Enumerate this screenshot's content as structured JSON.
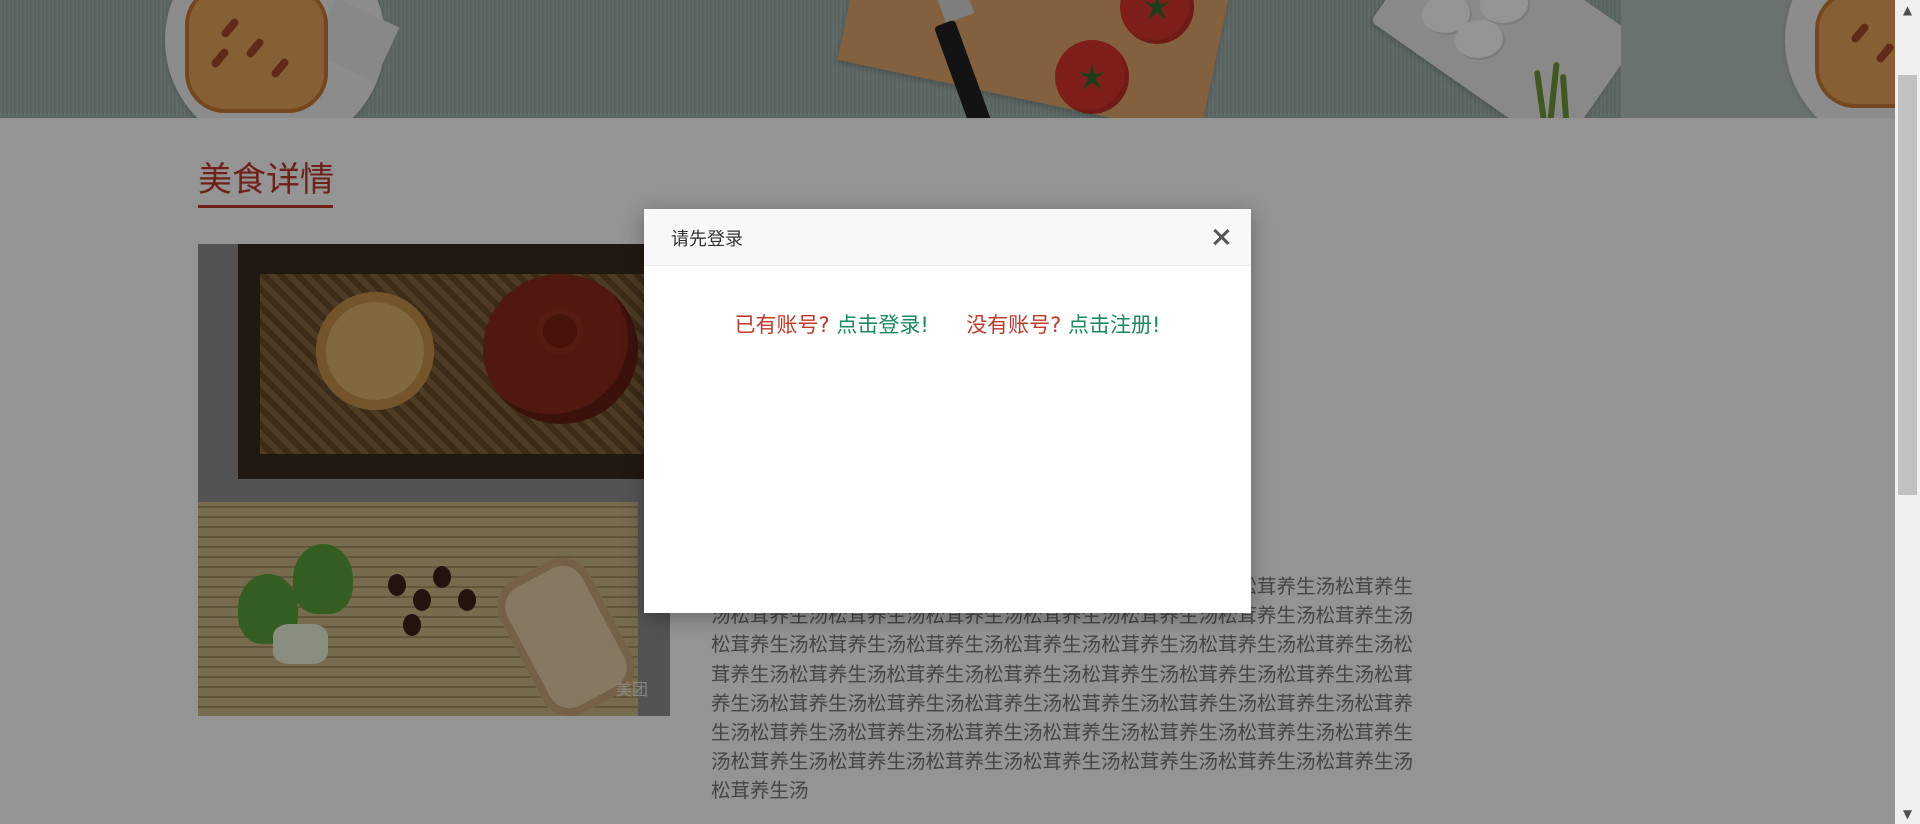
{
  "section": {
    "title": "美食详情"
  },
  "photo": {
    "watermark": "美团"
  },
  "description": {
    "text": "生汤松茸养生汤松茸养生汤松茸养生汤松茸养生汤松茸养生汤松茸养生汤松茸养生汤松茸养生汤松茸养生汤松茸养生汤松茸养生汤松茸养生汤松茸养生汤松茸养生汤松茸养生汤松茸养生汤松茸养生汤松茸养生汤松茸养生汤松茸养生汤松茸养生汤松茸养生汤松茸养生汤松茸养生汤松茸养生汤松茸养生汤松茸养生汤松茸养生汤松茸养生汤松茸养生汤松茸养生汤松茸养生汤松茸养生汤松茸养生汤松茸养生汤松茸养生汤松茸养生汤松茸养生汤松茸养生汤松茸养生汤松茸养生汤松茸养生汤松茸养生汤松茸养生汤松茸养生汤松茸养生汤松茸养生汤松茸养生汤松茸养生汤松茸养生汤松茸养生汤"
  },
  "modal": {
    "title": "请先登录",
    "has_account": "已有账号?",
    "login_link": "点击登录!",
    "no_account": "没有账号?",
    "register_link": "点击注册!"
  },
  "scrollbar": {
    "up_arrow": "▲",
    "down_arrow": "▼"
  }
}
